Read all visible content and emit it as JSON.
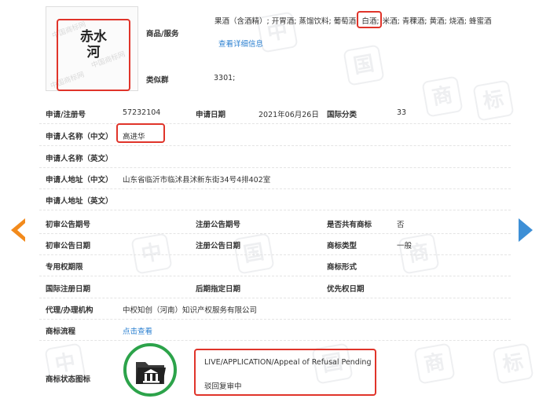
{
  "trademark": {
    "image_text": "赤水河",
    "goods_label": "商品/服务",
    "goods_list": "果酒（含酒精）; 开胃酒; 蒸馏饮料; 葡萄酒; 白酒; 米酒; 青稞酒; 黄酒; 烧酒; 蜂蜜酒",
    "goods_list_pre": "果酒（含酒精）; 开胃酒; 蒸馏饮料; 葡萄酒;",
    "goods_highlight": "白酒;",
    "goods_list_post": "米酒; 青稞酒; 黄酒; 烧酒; 蜂蜜酒",
    "view_details_link": "查看详细信息",
    "similar_group_label": "类似群",
    "similar_group_value": "3301;"
  },
  "fields": {
    "reg_no_label": "申请/注册号",
    "reg_no_value": "57232104",
    "app_date_label": "申请日期",
    "app_date_value": "2021年06月26日",
    "intl_class_label": "国际分类",
    "intl_class_value": "33",
    "applicant_cn_label": "申请人名称（中文）",
    "applicant_cn_value": "高进华",
    "applicant_en_label": "申请人名称（英文）",
    "address_cn_label": "申请人地址（中文）",
    "address_cn_value": "山东省临沂市临沭县沭新东街34号4排402室",
    "address_en_label": "申请人地址（英文）",
    "prelim_issue_label": "初审公告期号",
    "reg_issue_label": "注册公告期号",
    "shared_label": "是否共有商标",
    "shared_value": "否",
    "prelim_date_label": "初审公告日期",
    "reg_date_label": "注册公告日期",
    "tm_type_label": "商标类型",
    "tm_type_value": "一般",
    "exclusive_period_label": "专用权期限",
    "tm_form_label": "商标形式",
    "intl_reg_date_label": "国际注册日期",
    "later_date_label": "后期指定日期",
    "priority_date_label": "优先权日期",
    "agent_label": "代理/办理机构",
    "agent_value": "中权知创（河南）知识产权服务有限公司",
    "process_label": "商标流程",
    "process_link": "点击查看",
    "status_icon_label": "商标状态图标",
    "status_en": "LIVE/APPLICATION/Appeal of Refusal Pending",
    "status_cn": "驳回复审中"
  },
  "colors": {
    "highlight_red": "#e0342a",
    "link_blue": "#2a7fd0",
    "status_green": "#2ca34a",
    "nav_left_orange": "#f28a1c",
    "nav_right_blue": "#3d8fd6"
  },
  "icons": {
    "prev": "chevron-left-icon",
    "next": "chevron-right-icon",
    "status": "folder-courthouse-icon"
  }
}
